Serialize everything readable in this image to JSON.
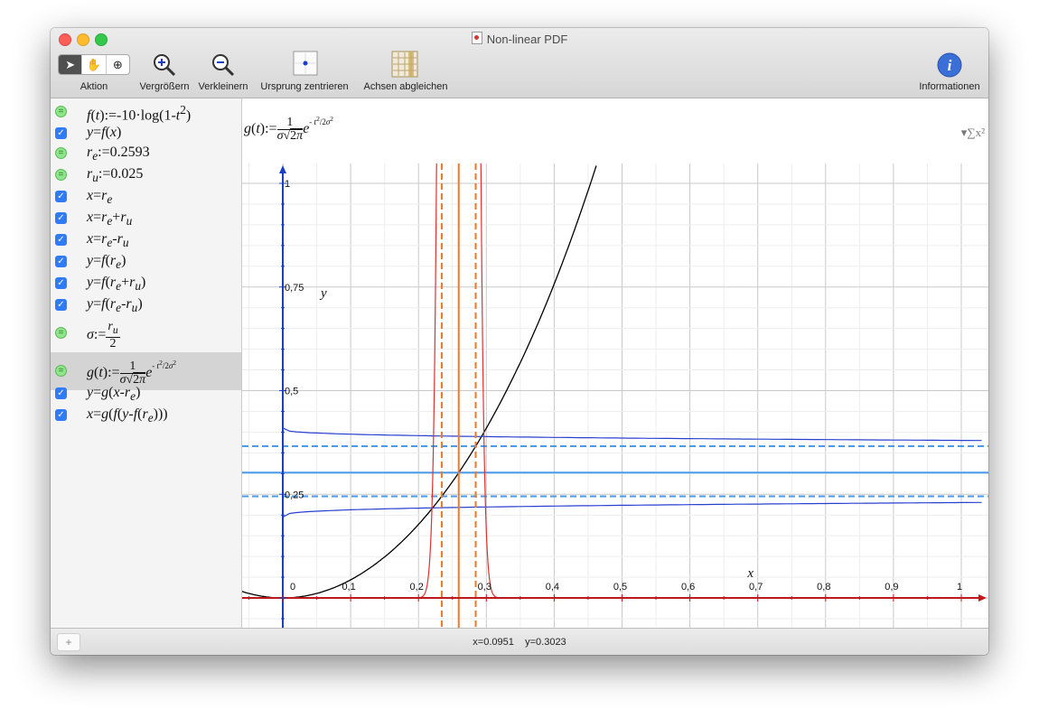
{
  "window": {
    "title": "Non-linear PDF"
  },
  "toolbar": {
    "action_label": "Aktion",
    "zoom_in_label": "Vergrößern",
    "zoom_out_label": "Verkleinern",
    "center_origin_label": "Ursprung zentrieren",
    "match_axes_label": "Achsen abgleichen",
    "info_label": "Informationen"
  },
  "sidebar": {
    "items": [
      {
        "type": "def",
        "html": "<i>f</i>(<i>t</i>):=-10·log(1-<i>t</i><sup>2</sup>)"
      },
      {
        "type": "check",
        "html": "<i>y</i>=<i>f</i>(<i>x</i>)"
      },
      {
        "type": "def",
        "html": "<i>r<sub>e</sub></i>:=0.2593"
      },
      {
        "type": "def",
        "html": "<i>r<sub>u</sub></i>:=0.025"
      },
      {
        "type": "check",
        "html": "<i>x</i>=<i>r<sub>e</sub></i>"
      },
      {
        "type": "check",
        "html": "<i>x</i>=<i>r<sub>e</sub></i>+<i>r<sub>u</sub></i>"
      },
      {
        "type": "check",
        "html": "<i>x</i>=<i>r<sub>e</sub></i>-<i>r<sub>u</sub></i>"
      },
      {
        "type": "check",
        "html": "<i>y</i>=<i>f</i>(<i>r<sub>e</sub></i>)"
      },
      {
        "type": "check",
        "html": "<i>y</i>=<i>f</i>(<i>r<sub>e</sub></i>+<i>r<sub>u</sub></i>)"
      },
      {
        "type": "check",
        "html": "<i>y</i>=<i>f</i>(<i>r<sub>e</sub></i>-<i>r<sub>u</sub></i>)"
      },
      {
        "type": "def",
        "html": "<i>σ</i>:=<span class=\"frac\"><span class=\"num\"><i>r<sub>u</sub></i></span><span class=\"den\">2</span></span>"
      },
      {
        "type": "def",
        "selected": true,
        "html": "<i>g</i>(<i>t</i>):=<span class=\"frac\"><span class=\"num\">1</span><span class=\"den\"><i>σ</i>√<span style=\"text-decoration:overline\">2<i>π</i></span></span></span><i>e</i><span class=\"expo\">- <i>t</i><sup>2</sup>/2<i>σ</i><sup>2</sup></span>"
      },
      {
        "type": "check",
        "html": "<i>y</i>=<i>g</i>(<i>x</i>-<i>r<sub>e</sub></i>)"
      },
      {
        "type": "check",
        "html": "<i>x</i>=<i>g</i>(<i>f</i>(<i>y</i>-<i>f</i>(<i>r<sub>e</sub></i>)))"
      }
    ]
  },
  "formula_display": "<i>g</i>(<i>t</i>):=<span class=\"frac\"><span class=\"num\">1</span><span class=\"den\"><i>σ</i>√<span style=\"text-decoration:overline\">2<i>π</i></span></span></span><i>e</i><span class=\"expo\">- <i>t</i><sup>2</sup>/2<i>σ</i><sup>2</sup></span>",
  "sigma_toggle": "▾∑x²",
  "graph": {
    "x_label": "x",
    "y_label": "y",
    "x_ticks": [
      "0",
      "0,1",
      "0,2",
      "0,3",
      "0,4",
      "0,5",
      "0,6",
      "0,7",
      "0,8",
      "0,9",
      "1"
    ],
    "y_ticks": [
      "0,25",
      "0,5",
      "0,75",
      "1"
    ],
    "params": {
      "re": 0.2593,
      "ru": 0.025
    },
    "colors": {
      "axis_x": "#c0191b",
      "axis_y": "#1a3fc4",
      "curve_f": "#000000",
      "vline": "#f07828",
      "hline": "#4a9ae8",
      "curve_g": "#e03030",
      "curve_inv": "#2a3fd0",
      "grid_major": "#c9c9c9",
      "grid_minor": "#ededed"
    }
  },
  "status": {
    "x_value": "x=0.0951",
    "y_value": "y=0.3023"
  },
  "add_button": "+"
}
